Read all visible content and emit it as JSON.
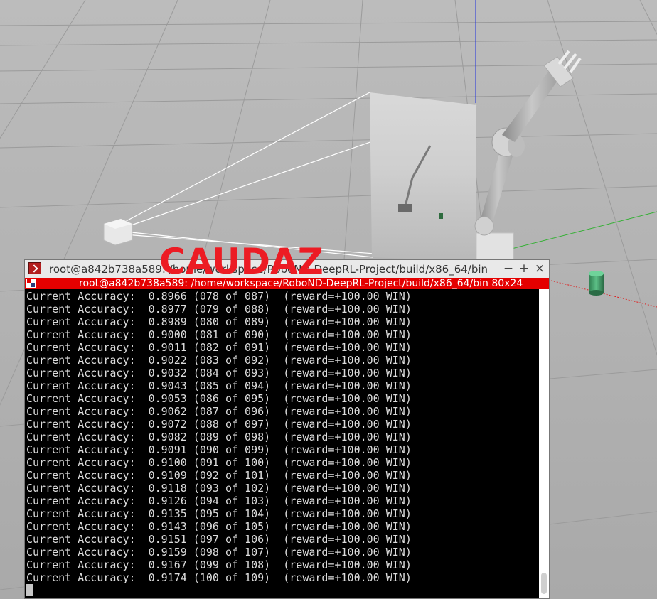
{
  "watermark": "CAUDAZ",
  "window": {
    "title": "root@a842b738a589: /home/workspace/RoboND-DeepRL-Project/build/x86_64/bin",
    "minimize_label": "−",
    "maximize_label": "+",
    "close_label": "×"
  },
  "tab": {
    "title": "root@a842b738a589: /home/workspace/RoboND-DeepRL-Project/build/x86_64/bin 80x24"
  },
  "terminal": {
    "lines": [
      "Current Accuracy:  0.8966 (078 of 087)  (reward=+100.00 WIN)",
      "Current Accuracy:  0.8977 (079 of 088)  (reward=+100.00 WIN)",
      "Current Accuracy:  0.8989 (080 of 089)  (reward=+100.00 WIN)",
      "Current Accuracy:  0.9000 (081 of 090)  (reward=+100.00 WIN)",
      "Current Accuracy:  0.9011 (082 of 091)  (reward=+100.00 WIN)",
      "Current Accuracy:  0.9022 (083 of 092)  (reward=+100.00 WIN)",
      "Current Accuracy:  0.9032 (084 of 093)  (reward=+100.00 WIN)",
      "Current Accuracy:  0.9043 (085 of 094)  (reward=+100.00 WIN)",
      "Current Accuracy:  0.9053 (086 of 095)  (reward=+100.00 WIN)",
      "Current Accuracy:  0.9062 (087 of 096)  (reward=+100.00 WIN)",
      "Current Accuracy:  0.9072 (088 of 097)  (reward=+100.00 WIN)",
      "Current Accuracy:  0.9082 (089 of 098)  (reward=+100.00 WIN)",
      "Current Accuracy:  0.9091 (090 of 099)  (reward=+100.00 WIN)",
      "Current Accuracy:  0.9100 (091 of 100)  (reward=+100.00 WIN)",
      "Current Accuracy:  0.9109 (092 of 101)  (reward=+100.00 WIN)",
      "Current Accuracy:  0.9118 (093 of 102)  (reward=+100.00 WIN)",
      "Current Accuracy:  0.9126 (094 of 103)  (reward=+100.00 WIN)",
      "Current Accuracy:  0.9135 (095 of 104)  (reward=+100.00 WIN)",
      "Current Accuracy:  0.9143 (096 of 105)  (reward=+100.00 WIN)",
      "Current Accuracy:  0.9151 (097 of 106)  (reward=+100.00 WIN)",
      "Current Accuracy:  0.9159 (098 of 107)  (reward=+100.00 WIN)",
      "Current Accuracy:  0.9167 (099 of 108)  (reward=+100.00 WIN)",
      "Current Accuracy:  0.9174 (100 of 109)  (reward=+100.00 WIN)"
    ]
  },
  "colors": {
    "ground": "#a7a7a7",
    "terminal_bg": "#000000",
    "terminal_fg": "#dcdcdc",
    "tab_bar": "#e40000",
    "watermark": "#ec1c24"
  },
  "icons": {
    "terminal_app": "terminal-app-icon",
    "tab": "tab-split-icon",
    "minimize": "minimize-icon",
    "maximize": "maximize-icon",
    "close": "close-icon"
  }
}
